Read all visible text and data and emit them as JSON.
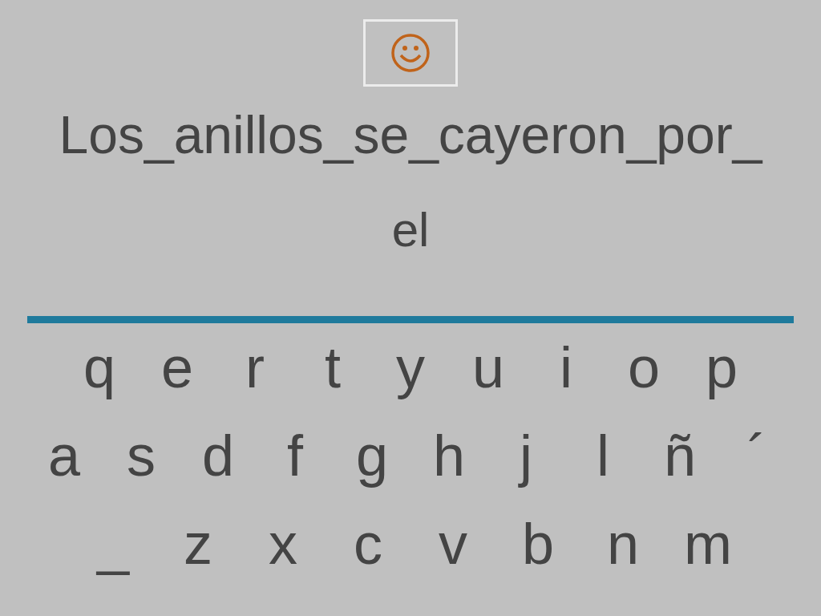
{
  "sentence": "Los_anillos_se_cayeron_por_",
  "answer": "el",
  "keyboard": [
    [
      "q",
      "e",
      "r",
      "t",
      "y",
      "u",
      "i",
      "o",
      "p"
    ],
    [
      "a",
      "s",
      "d",
      "f",
      "g",
      "h",
      "j",
      "l",
      "ñ",
      "´"
    ],
    [
      "_",
      "z",
      "x",
      "c",
      "v",
      "b",
      "n",
      "m"
    ]
  ]
}
